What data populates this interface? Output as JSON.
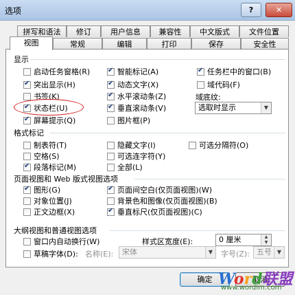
{
  "window": {
    "title": "选项",
    "help_label": "?",
    "close_label": "✕"
  },
  "tabs_back": [
    "拼写和语法",
    "修订",
    "用户信息",
    "兼容性",
    "中文版式",
    "文件位置"
  ],
  "tabs_front": [
    "视图",
    "常规",
    "编辑",
    "打印",
    "保存",
    "安全性"
  ],
  "active_tab": "视图",
  "display": {
    "title": "显示",
    "items": [
      {
        "label": "启动任务窗格(R)",
        "checked": false
      },
      {
        "label": "突出显示(H)",
        "checked": true
      },
      {
        "label": "书签(K)",
        "checked": false
      },
      {
        "label": "状态栏(U)",
        "checked": true
      },
      {
        "label": "屏幕提示(Q)",
        "checked": true
      },
      {
        "label": "智能标记(A)",
        "checked": true
      },
      {
        "label": "动态文字(X)",
        "checked": true
      },
      {
        "label": "水平滚动条(Z)",
        "checked": true
      },
      {
        "label": "垂直滚动条(V)",
        "checked": true
      },
      {
        "label": "图片框(P)",
        "checked": false
      },
      {
        "label": "任务栏中的窗口(B)",
        "checked": true
      },
      {
        "label": "域代码(F)",
        "checked": false
      }
    ],
    "shading_label": "域底纹:",
    "shading_value": "选取时显示"
  },
  "format_marks": {
    "title": "格式标记",
    "items": [
      {
        "label": "制表符(T)",
        "checked": false
      },
      {
        "label": "空格(S)",
        "checked": false
      },
      {
        "label": "段落标记(M)",
        "checked": true
      },
      {
        "label": "隐藏文字(I)",
        "checked": false
      },
      {
        "label": "可选连字符(Y)",
        "checked": false
      },
      {
        "label": "全部(L)",
        "checked": false
      },
      {
        "label": "可选分隔符(O)",
        "checked": false
      }
    ]
  },
  "print_web": {
    "title": "页面视图和 Web 版式视图选项",
    "items": [
      {
        "label": "图形(G)",
        "checked": true
      },
      {
        "label": "对象位置(J)",
        "checked": false
      },
      {
        "label": "正文边框(X)",
        "checked": false
      },
      {
        "label": "页面间空白(仅页面视图)(W)",
        "checked": true
      },
      {
        "label": "背景色和图像(仅页面视图)(B)",
        "checked": false
      },
      {
        "label": "垂直标尺(仅页面视图)(C)",
        "checked": true
      }
    ]
  },
  "outline": {
    "title": "大纲视图和普通视图选项",
    "wrap_label": "窗口内自动换行(W)",
    "wrap_checked": false,
    "draft_label": "草稿字体(D):",
    "draft_checked": false,
    "name_label": "名称(E):",
    "name_value": "宋体",
    "size_label": "字号(Z):",
    "size_value": "五号",
    "style_width_label": "样式区宽度(E):",
    "style_width_value": "0 厘米"
  },
  "buttons": {
    "ok": "确定",
    "cancel": "取消"
  },
  "watermark": {
    "brand": "Word联盟",
    "url": "www.wordlm.com"
  }
}
